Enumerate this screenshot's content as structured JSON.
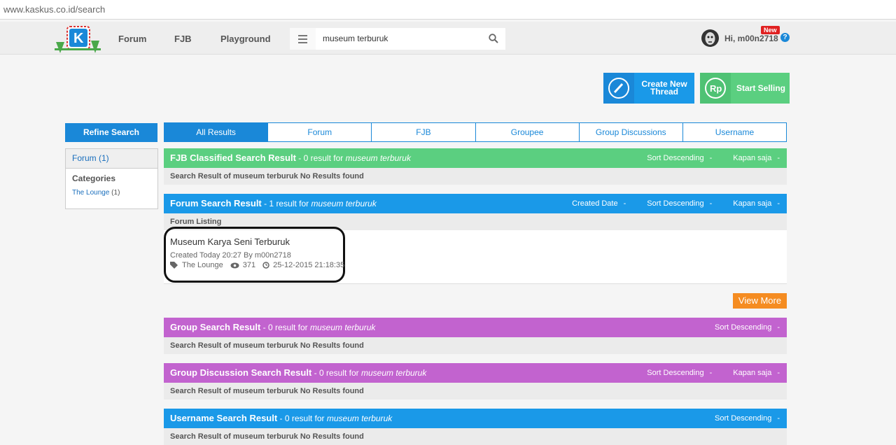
{
  "browser": {
    "url": "www.kaskus.co.id/search"
  },
  "nav": {
    "links": [
      "Forum",
      "FJB",
      "Playground"
    ],
    "search_value": "museum terburuk",
    "greeting": "Hi, m00n2718",
    "new_badge": "New",
    "help": "?"
  },
  "actions": {
    "create_thread": "Create New Thread",
    "start_selling": "Start Selling"
  },
  "sidebar": {
    "refine_label": "Refine Search",
    "forum_filter": "Forum (1)",
    "categories_label": "Categories",
    "lounge_link": "The Lounge",
    "lounge_count": "(1)"
  },
  "tabs": [
    "All Results",
    "Forum",
    "FJB",
    "Groupee",
    "Group Discussions",
    "Username"
  ],
  "fjb": {
    "title": "FJB Classified Search Result",
    "count_text": " - 0 result for ",
    "query": "museum terburuk",
    "sort": "Sort Descending",
    "time": "Kapan saja",
    "body": "Search Result of museum terburuk No Results found"
  },
  "forum": {
    "title": "Forum Search Result",
    "count_text": " - 1 result for ",
    "query": "museum terburuk",
    "created": "Created Date",
    "sort": "Sort Descending",
    "time": "Kapan saja",
    "listing_label": "Forum Listing",
    "thread": {
      "title": "Museum Karya Seni Terburuk",
      "meta": "Created Today 20:27 By m00n2718",
      "category": "The Lounge",
      "views": "371",
      "last_post": "25-12-2015 21:18:35"
    },
    "view_more": "View More"
  },
  "group": {
    "title": "Group Search Result",
    "count_text": " - 0 result for ",
    "query": "museum terburuk",
    "sort": "Sort Descending",
    "body": "Search Result of museum terburuk No Results found"
  },
  "group_discussion": {
    "title": "Group Discussion Search Result",
    "count_text": " - 0 result for ",
    "query": "museum terburuk",
    "sort": "Sort Descending",
    "time": "Kapan saja",
    "body": "Search Result of museum terburuk No Results found"
  },
  "username": {
    "title": "Username Search Result",
    "count_text": " - 0 result for ",
    "query": "museum terburuk",
    "sort": "Sort Descending",
    "body": "Search Result of museum terburuk No Results found"
  },
  "caret": "-",
  "colors": {
    "blue": "#1a99e8",
    "green": "#5bcf80",
    "purple": "#c263cf",
    "orange": "#f58c21"
  }
}
